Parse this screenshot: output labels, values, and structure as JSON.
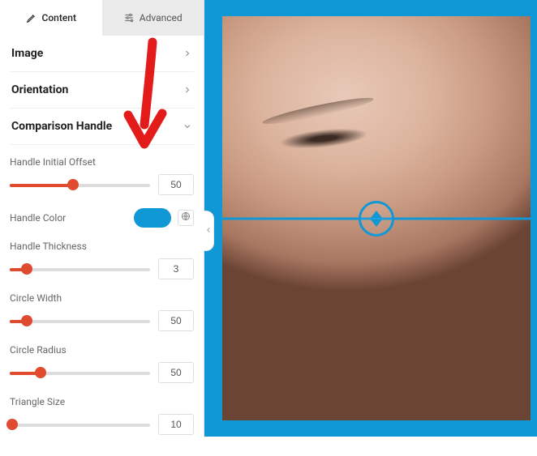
{
  "tabs": {
    "content": "Content",
    "advanced": "Advanced"
  },
  "sections": {
    "image": {
      "title": "Image"
    },
    "orientation": {
      "title": "Orientation"
    },
    "comparison_handle": {
      "title": "Comparison Handle",
      "controls": {
        "initial_offset": {
          "label": "Handle Initial Offset",
          "value": "50",
          "percent": 45
        },
        "handle_color": {
          "label": "Handle Color",
          "color": "#1097d5"
        },
        "thickness": {
          "label": "Handle Thickness",
          "value": "3",
          "percent": 12
        },
        "circle_width": {
          "label": "Circle Width",
          "value": "50",
          "percent": 12
        },
        "circle_radius": {
          "label": "Circle Radius",
          "value": "50",
          "percent": 22
        },
        "triangle_size": {
          "label": "Triangle Size",
          "value": "10",
          "percent": 2
        }
      }
    }
  },
  "preview": {
    "handle_color": "#1097d5"
  }
}
